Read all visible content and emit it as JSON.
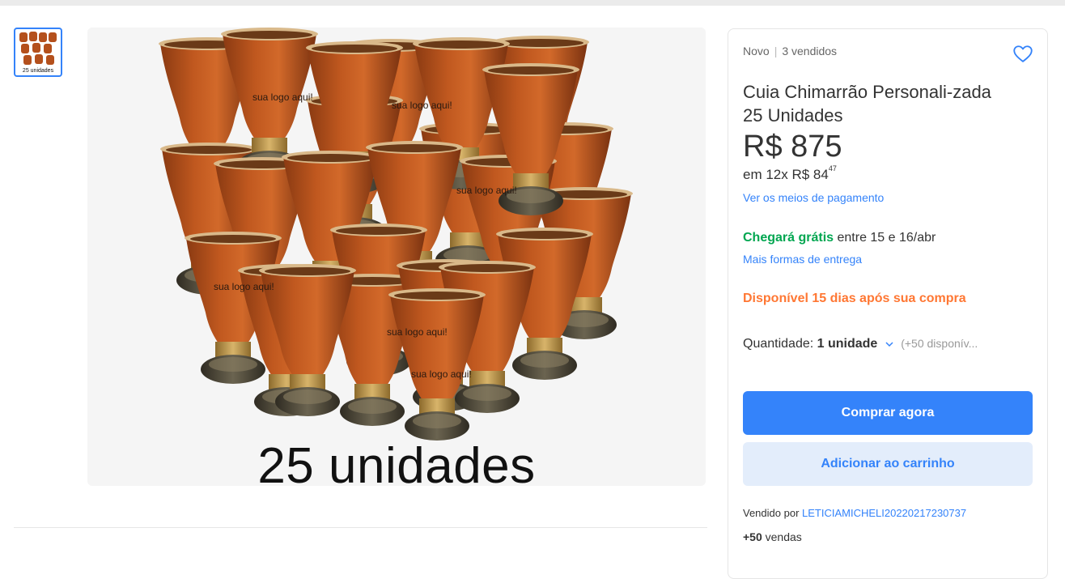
{
  "gallery": {
    "thumb_caption": "25 unidades",
    "image_caption": "25 unidades",
    "engraving_text": "sua logo aqui!"
  },
  "product": {
    "condition": "Novo",
    "separator": "|",
    "sold": "3 vendidos",
    "title": "Cuia Chimarrão Personali-zada 25 Unidades",
    "price": "R$ 875",
    "installments_prefix": "em 12x R$ 84",
    "installments_cents": "47",
    "payment_link": "Ver os meios de pagamento"
  },
  "shipping": {
    "free_label": "Chegará grátis",
    "date_text": " entre 15 e 16/abr",
    "more_link": "Mais formas de entrega"
  },
  "availability": "Disponível 15 dias após sua compra",
  "quantity": {
    "label": "Quantidade: ",
    "value": "1 unidade",
    "stock": "(+50 disponív..."
  },
  "actions": {
    "buy_label": "Comprar agora",
    "cart_label": "Adicionar ao carrinho"
  },
  "seller": {
    "prefix": "Vendido por ",
    "name": "LETICIAMICHELI20220217230737",
    "sales_count": "+50",
    "sales_suffix": " vendas"
  },
  "colors": {
    "accent": "#3483fa",
    "free_shipping": "#00a650",
    "availability": "#ff7733",
    "cup_body": "#b4501c",
    "cup_base": "#4a4535"
  },
  "icons": {
    "favorite": "heart-outline-icon",
    "quantity_dropdown": "chevron-down-icon"
  }
}
